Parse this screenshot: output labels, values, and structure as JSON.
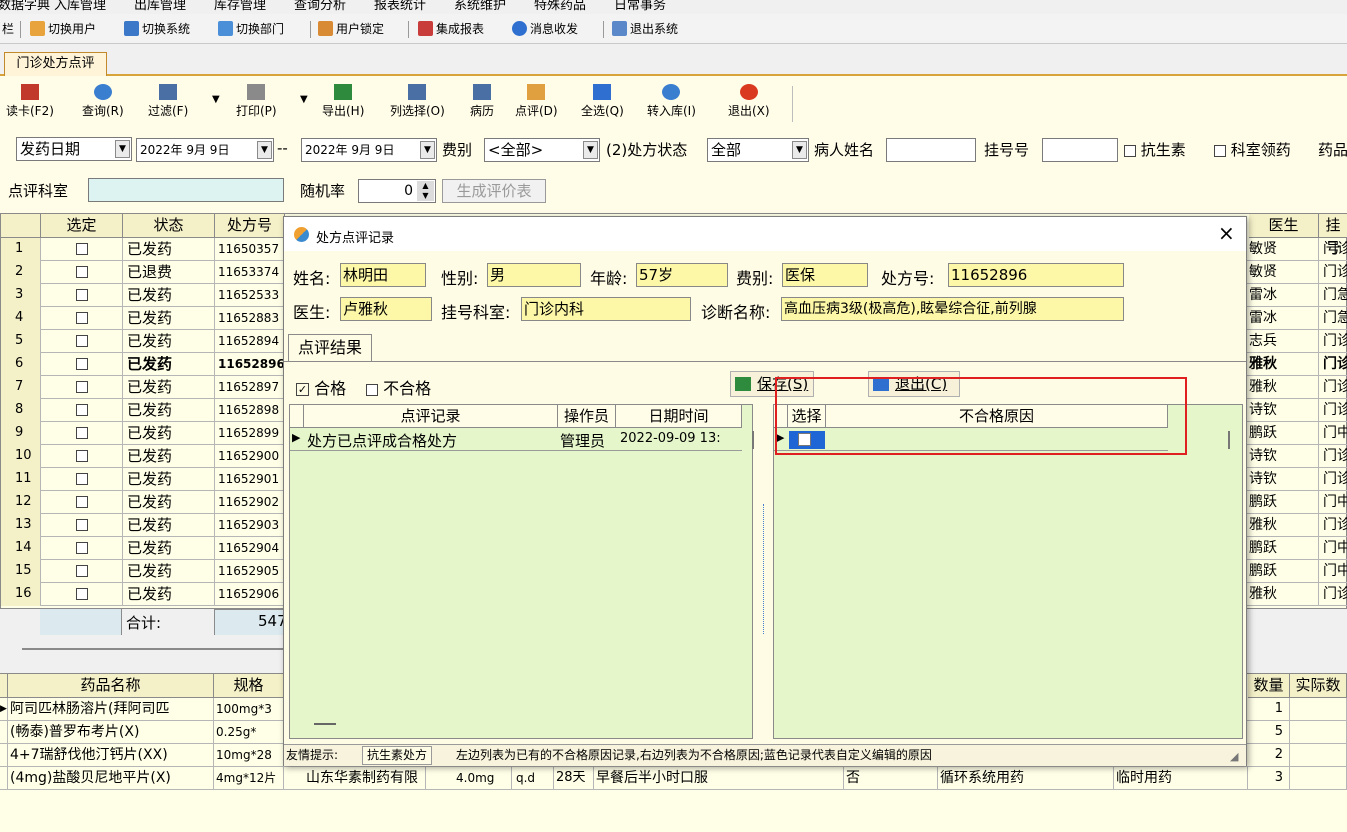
{
  "menu": {
    "items": [
      "数据字典",
      "入库管理",
      "出库管理",
      "库存管理",
      "查询分析",
      "报表统计",
      "系统维护",
      "特殊药品",
      "日常事务"
    ]
  },
  "quickbar": {
    "lead": "栏",
    "switch_user": "切换用户",
    "switch_system": "切换系统",
    "switch_dept": "切换部门",
    "user_lock": "用户锁定",
    "integrated_report": "集成报表",
    "messages": "消息收发",
    "exit_system": "退出系统"
  },
  "tab": {
    "label": "门诊处方点评"
  },
  "ribbon": {
    "read_card": "读卡(F2)",
    "query": "查询(R)",
    "filter": "过滤(F)",
    "print": "打印(P)",
    "export": "导出(H)",
    "column_select": "列选择(O)",
    "medical_record": "病历",
    "review": "点评(D)",
    "select_all": "全选(Q)",
    "transfer_in": "转入库(I)",
    "exit": "退出(X)"
  },
  "filters": {
    "date_type": "发药日期",
    "date_from": "2022年 9月 9日",
    "date_sep": "--",
    "date_to": "2022年 9月 9日",
    "fee_label": "费别",
    "fee_value": "<全部>",
    "status_label": "(2)处方状态",
    "status_value": "全部",
    "patient_label": "病人姓名",
    "reg_label": "挂号号",
    "antibiotic_label": "抗生素",
    "dept_collect_label": "科室领药",
    "drug_label": "药品",
    "review_dept_label": "点评科室",
    "random_label": "随机率",
    "random_value": "0",
    "generate_btn": "生成评价表"
  },
  "grid": {
    "headers": {
      "select": "选定",
      "status": "状态",
      "rx_no": "处方号",
      "doctor": "医生",
      "reg": "挂号"
    },
    "rows": [
      {
        "n": "1",
        "status": "已发药",
        "rx": "11650357",
        "doctor": "敏贤",
        "reg": "门诊"
      },
      {
        "n": "2",
        "status": "已退费",
        "rx": "11653374",
        "doctor": "敏贤",
        "reg": "门诊"
      },
      {
        "n": "3",
        "status": "已发药",
        "rx": "11652533",
        "doctor": "雷冰",
        "reg": "门急"
      },
      {
        "n": "4",
        "status": "已发药",
        "rx": "11652883",
        "doctor": "雷冰",
        "reg": "门急"
      },
      {
        "n": "5",
        "status": "已发药",
        "rx": "11652894",
        "doctor": "志兵",
        "reg": "门诊"
      },
      {
        "n": "6",
        "status": "已发药",
        "rx": "11652896",
        "doctor": "雅秋",
        "reg": "门诊"
      },
      {
        "n": "7",
        "status": "已发药",
        "rx": "11652897",
        "doctor": "雅秋",
        "reg": "门诊"
      },
      {
        "n": "8",
        "status": "已发药",
        "rx": "11652898",
        "doctor": "诗钦",
        "reg": "门诊"
      },
      {
        "n": "9",
        "status": "已发药",
        "rx": "11652899",
        "doctor": "鹏跃",
        "reg": "门中"
      },
      {
        "n": "10",
        "status": "已发药",
        "rx": "11652900",
        "doctor": "诗钦",
        "reg": "门诊"
      },
      {
        "n": "11",
        "status": "已发药",
        "rx": "11652901",
        "doctor": "诗钦",
        "reg": "门诊"
      },
      {
        "n": "12",
        "status": "已发药",
        "rx": "11652902",
        "doctor": "鹏跃",
        "reg": "门中"
      },
      {
        "n": "13",
        "status": "已发药",
        "rx": "11652903",
        "doctor": "雅秋",
        "reg": "门诊"
      },
      {
        "n": "14",
        "status": "已发药",
        "rx": "11652904",
        "doctor": "鹏跃",
        "reg": "门中"
      },
      {
        "n": "15",
        "status": "已发药",
        "rx": "11652905",
        "doctor": "鹏跃",
        "reg": "门中"
      },
      {
        "n": "16",
        "status": "已发药",
        "rx": "11652906",
        "doctor": "雅秋",
        "reg": "门诊"
      }
    ],
    "total_label": "合计:",
    "total_value": "547"
  },
  "lower": {
    "headers": {
      "name": "药品名称",
      "spec": "规格",
      "qty": "数量",
      "actual": "实际数"
    },
    "rows": [
      {
        "name": "阿司匹林肠溶片(拜阿司匹",
        "spec": "100mg*3",
        "qty": "1"
      },
      {
        "name": "(畅泰)普罗布考片(X)",
        "spec": "0.25g*",
        "qty": "5"
      },
      {
        "name": "4+7瑞舒伐他汀钙片(XX)",
        "spec": "10mg*28",
        "qty": "2"
      },
      {
        "name": "(4mg)盐酸贝尼地平片(X)",
        "spec": "4mg*12片",
        "maker": "山东华素制药有限",
        "dose": "4.0mg",
        "freq": "q.d",
        "days": "28天",
        "usage": "早餐后半小时口服",
        "flag": "否",
        "category": "循环系统用药",
        "type": "临时用药",
        "qty": "3"
      }
    ]
  },
  "dialog": {
    "title": "处方点评记录",
    "name_label": "姓名:",
    "name": "林明田",
    "sex_label": "性别:",
    "sex": "男",
    "age_label": "年龄:",
    "age": "57岁",
    "fee_label": "费别:",
    "fee": "医保",
    "rx_label": "处方号:",
    "rx": "11652896",
    "doctor_label": "医生:",
    "doctor": "卢雅秋",
    "dept_label": "挂号科室:",
    "dept": "门诊内科",
    "diag_label": "诊断名称:",
    "diag": "高血压病3级(极高危),眩晕综合征,前列腺",
    "result_tab": "点评结果",
    "pass_label": "合格",
    "fail_label": "不合格",
    "save_btn": "保存(S)",
    "exit_btn": "退出(C)",
    "left_headers": {
      "record": "点评记录",
      "operator": "操作员",
      "datetime": "日期时间"
    },
    "left_rows": [
      {
        "record": "处方已点评成合格处方",
        "operator": "管理员",
        "datetime": "2022-09-09 13:"
      }
    ],
    "right_headers": {
      "select": "选择",
      "reason": "不合格原因"
    },
    "status_tip_label": "友情提示:",
    "status_tip_tag": "抗生素处方",
    "status_text": "左边列表为已有的不合格原因记录,右边列表为不合格原因;蓝色记录代表自定义编辑的原因"
  }
}
